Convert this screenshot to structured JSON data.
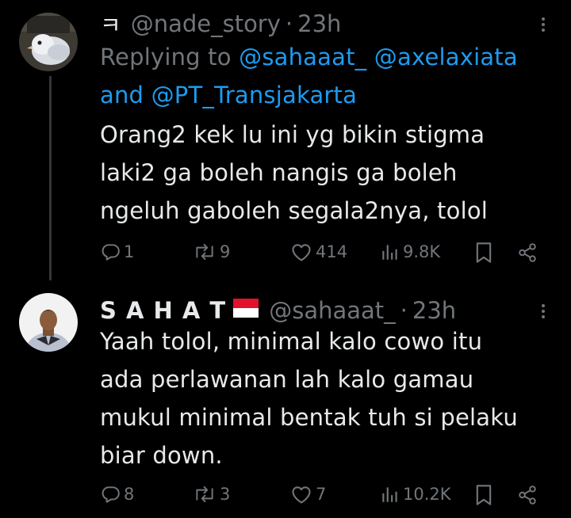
{
  "tweets": [
    {
      "name_prefix": "ㅋ",
      "handle": "@nade_story",
      "dot": "·",
      "time": "23h",
      "reply_prefix": "Replying to",
      "reply_mention_1": "@sahaaat_",
      "reply_mention_2": "@axelaxiata",
      "reply_and": "and",
      "reply_mention_3": "@PT_Transjakarta",
      "lines": [
        "Orang2 kek lu ini yg bikin stigma",
        "laki2 ga boleh nangis ga boleh",
        "ngeluh gaboleh segala2nya, tolol"
      ],
      "stats": {
        "replies": "1",
        "retweets": "9",
        "likes": "414",
        "views": "9.8K"
      }
    },
    {
      "name": "S A H A T",
      "flag": "indonesia-flag",
      "handle": "@sahaaat_",
      "dot": "·",
      "time": "23h",
      "lines": [
        "Yaah tolol, minimal kalo cowo itu",
        "ada perlawanan lah kalo gamau",
        "mukul minimal bentak tuh si pelaku",
        "biar down."
      ],
      "stats": {
        "replies": "8",
        "retweets": "3",
        "likes": "7",
        "views": "10.2K"
      }
    }
  ],
  "colors": {
    "background": "#000000",
    "text": "#e7e9ea",
    "muted": "#71767b",
    "link": "#1d9bf0"
  }
}
